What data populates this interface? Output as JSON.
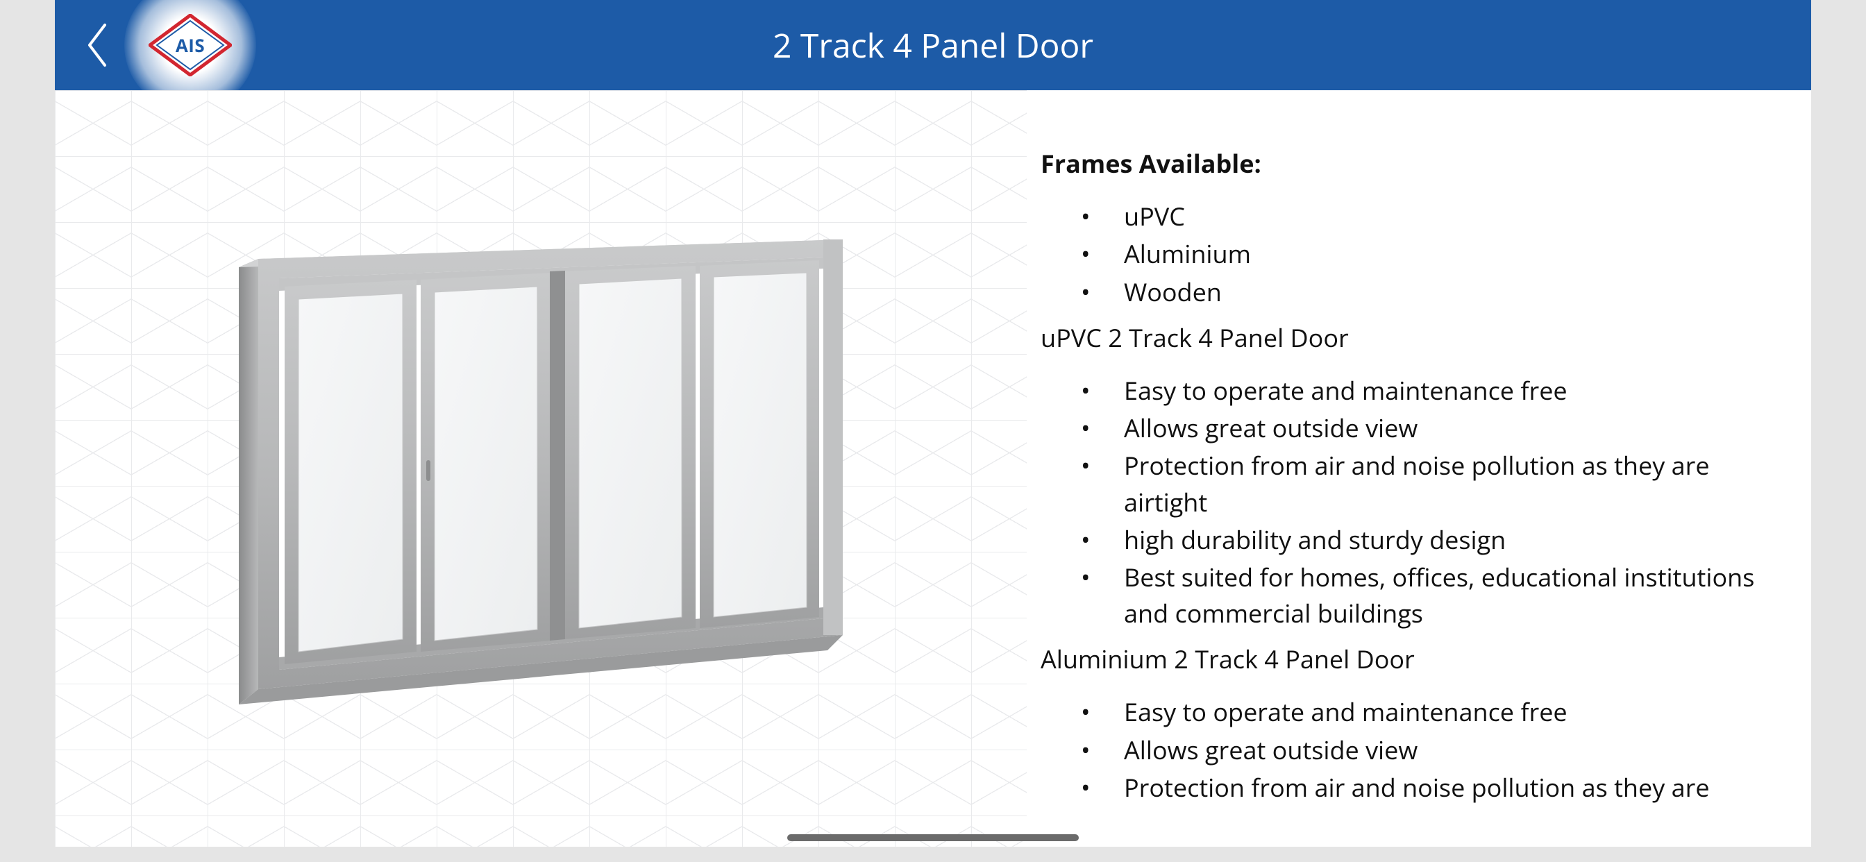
{
  "header": {
    "page_title": "2 Track 4 Panel Door",
    "logo_text": "AIS"
  },
  "details": {
    "frames_heading": "Frames Available:",
    "frame_options": [
      "uPVC",
      "Aluminium",
      "Wooden"
    ],
    "variant1_heading": "uPVC 2 Track 4 Panel Door",
    "variant1_bullets": [
      "Easy to operate and maintenance free",
      "Allows great outside view",
      "Protection from air and noise pollution as they are airtight",
      "high durability and sturdy design",
      "Best suited for homes, offices, educational institutions and commercial buildings"
    ],
    "variant2_heading": "Aluminium 2 Track 4 Panel Door",
    "variant2_bullets": [
      "Easy to operate and maintenance free",
      "Allows great outside view",
      "Protection from air and noise pollution as they are"
    ]
  }
}
